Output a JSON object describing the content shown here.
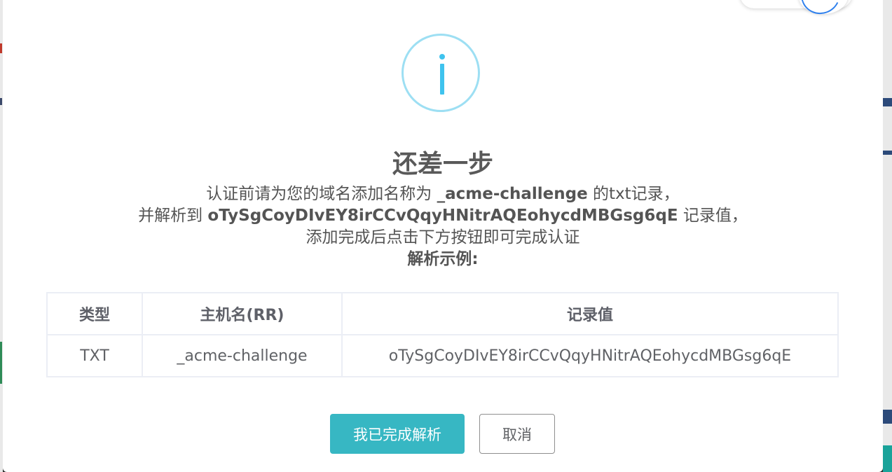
{
  "dialog": {
    "title": "还差一步",
    "line1_prefix": "认证前请为您的域名添加名称为 ",
    "line1_name": "_acme-challenge",
    "line1_suffix": " 的txt记录，",
    "line2_prefix": "并解析到 ",
    "line2_value": "oTySgCoyDIvEY8irCCvQqyHNitrAQEohycdMBGsg6qE",
    "line2_suffix": " 记录值，",
    "line3": "添加完成后点击下方按钮即可完成认证",
    "example_heading": "解析示例:"
  },
  "table": {
    "headers": [
      "类型",
      "主机名(RR)",
      "记录值"
    ],
    "rows": [
      [
        "TXT",
        "_acme-challenge",
        "oTySgCoyDIvEY8irCCvQqyHNitrAQEohycdMBGsg6qE"
      ]
    ]
  },
  "buttons": {
    "confirm_label": "我已完成解析",
    "cancel_label": "取消"
  },
  "colors": {
    "accent": "#37b7c3",
    "info_icon": "#3fc3ee"
  },
  "icons": {
    "header_icon": "info-icon"
  }
}
